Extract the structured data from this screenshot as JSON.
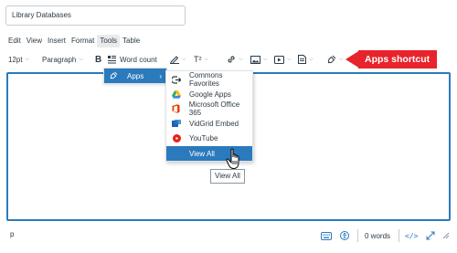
{
  "title_field": {
    "value": "Library Databases"
  },
  "menubar": {
    "items": [
      "Edit",
      "View",
      "Insert",
      "Format",
      "Tools",
      "Table"
    ]
  },
  "toolbar": {
    "font_size": "12pt",
    "block_format": "Paragraph",
    "bold": "B",
    "word_count": "Word count",
    "superscript": "T²"
  },
  "tools_menu": {
    "apps_label": "Apps"
  },
  "apps_submenu": {
    "items": [
      {
        "label": "Commons Favorites",
        "icon": "commons-favorites-icon"
      },
      {
        "label": "Google Apps",
        "icon": "google-drive-icon"
      },
      {
        "label": "Microsoft Office 365",
        "icon": "office-365-icon"
      },
      {
        "label": "VidGrid Embed",
        "icon": "vidgrid-icon"
      },
      {
        "label": "YouTube",
        "icon": "youtube-icon"
      },
      {
        "label": "View All",
        "icon": ""
      }
    ]
  },
  "tooltip": {
    "text": "View All"
  },
  "annotation": {
    "text": "Apps shortcut",
    "color": "#e8232b"
  },
  "statusbar": {
    "path": "p",
    "word_count": "0 words"
  },
  "colors": {
    "accent": "#2b7abc",
    "annotation_red": "#e8232b"
  }
}
